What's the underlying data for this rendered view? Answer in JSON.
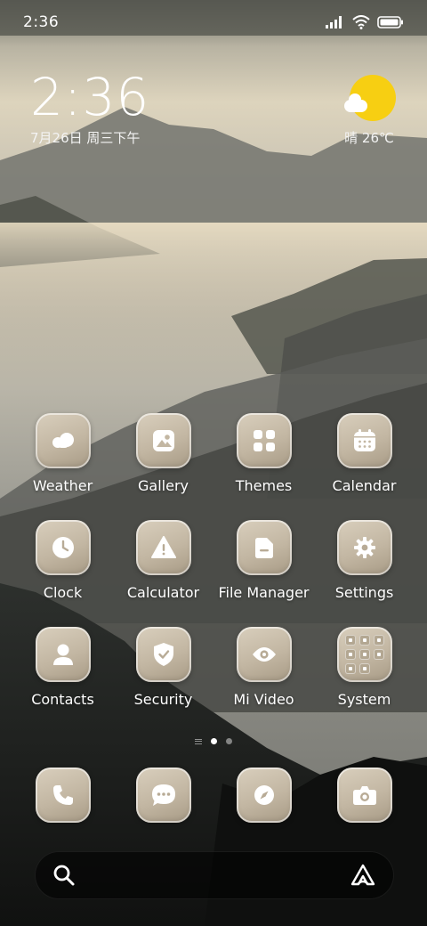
{
  "status_bar": {
    "time": "2:36",
    "icons": [
      "signal-icon",
      "wifi-icon",
      "battery-icon"
    ]
  },
  "clock_widget": {
    "time": "2:36",
    "date": "7月26日 周三下午"
  },
  "weather_widget": {
    "icon": "sunny-cloud-icon",
    "text": "晴 26℃"
  },
  "apps": [
    {
      "label": "Weather",
      "icon": "weather-icon"
    },
    {
      "label": "Gallery",
      "icon": "gallery-icon"
    },
    {
      "label": "Themes",
      "icon": "themes-icon"
    },
    {
      "label": "Calendar",
      "icon": "calendar-icon"
    },
    {
      "label": "Clock",
      "icon": "clock-icon"
    },
    {
      "label": "Calculator",
      "icon": "calculator-icon"
    },
    {
      "label": "File Manager",
      "icon": "file-manager-icon"
    },
    {
      "label": "Settings",
      "icon": "settings-icon"
    },
    {
      "label": "Contacts",
      "icon": "contacts-icon"
    },
    {
      "label": "Security",
      "icon": "security-icon"
    },
    {
      "label": "Mi Video",
      "icon": "mi-video-icon"
    },
    {
      "label": "System",
      "icon": "folder-icon"
    }
  ],
  "page_indicator": {
    "pages": 2,
    "active": 1
  },
  "dock": [
    {
      "icon": "phone-icon"
    },
    {
      "icon": "messages-icon"
    },
    {
      "icon": "browser-icon"
    },
    {
      "icon": "camera-icon"
    }
  ],
  "search_bar": {
    "left_icon": "search-icon",
    "right_icon": "assistant-icon"
  },
  "colors": {
    "icon_tint": "#ffffff",
    "icon_background": "#c9bea9",
    "sun": "#f7cf12"
  }
}
